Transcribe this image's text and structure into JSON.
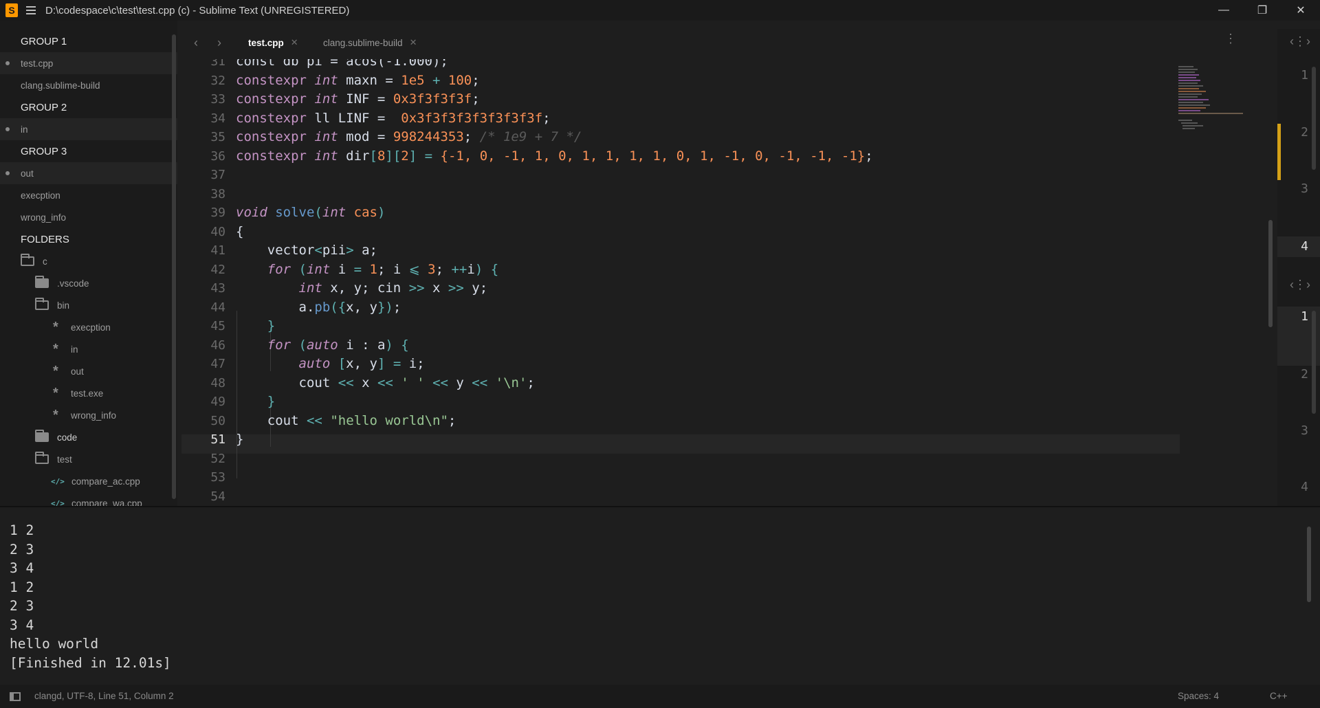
{
  "window": {
    "title": "D:\\codespace\\c\\test\\test.cpp (c) - Sublime Text (UNREGISTERED)",
    "minimize": "—",
    "restore": "❐",
    "close": "✕"
  },
  "sidebar": {
    "group1": "GROUP 1",
    "group1_files": [
      "test.cpp",
      "clang.sublime-build"
    ],
    "group2": "GROUP 2",
    "group2_files": [
      "in"
    ],
    "group3": "GROUP 3",
    "group3_files": [
      "out",
      "execption",
      "wrong_info"
    ],
    "folders_label": "FOLDERS",
    "tree": {
      "root": "c",
      "vscode": ".vscode",
      "bin": "bin",
      "bin_files": [
        "execption",
        "in",
        "out",
        "test.exe",
        "wrong_info"
      ],
      "code": "code",
      "test": "test",
      "test_files": [
        "compare_ac.cpp",
        "compare_wa.cpp"
      ]
    }
  },
  "tabs": [
    {
      "label": "test.cpp",
      "active": true
    },
    {
      "label": "clang.sublime-build",
      "active": false
    }
  ],
  "editor": {
    "first_line_fragment": "const db pi = acos(-1.000);",
    "line_numbers": [
      "31",
      "32",
      "33",
      "34",
      "35",
      "36",
      "37",
      "38",
      "39",
      "40",
      "41",
      "42",
      "43",
      "44",
      "45",
      "46",
      "47",
      "48",
      "49",
      "50",
      "51",
      "52",
      "53",
      "54"
    ],
    "current_line": "51",
    "tokens": {
      "constexpr": "constexpr",
      "int": "int",
      "ll": "ll",
      "maxn": " maxn = ",
      "maxn_v1": "1e5",
      "plus": " + ",
      "maxn_v2": "100",
      "inf": " INF = ",
      "inf_v": "0x3f3f3f3f",
      "linf": " LINF =  ",
      "linf_v": "0x3f3f3f3f3f3f3f3f",
      "mod": " mod = ",
      "mod_v": "998244353",
      "mod_c": "/* 1e9 + 7 */",
      "dir": " dir",
      "dir_vals": "{-1, 0, -1, 1, 0, 1, 1, 1, 1, 0, 1, -1, 0, -1, -1, -1}",
      "void": "void",
      "solve": "solve",
      "cas": "cas",
      "vector": "vector",
      "pii": "pii",
      "for": "for",
      "auto": "auto",
      "cin": "cin",
      "cout": "cout",
      "pb": "pb",
      "nl": "'\\n'",
      "sp": "' '",
      "hello": "\"hello world\\n\""
    }
  },
  "right_pane": {
    "top_numbers": [
      "1",
      "2",
      "3",
      "4"
    ],
    "bottom_numbers": [
      "1",
      "2",
      "3",
      "4"
    ]
  },
  "output": {
    "lines": [
      "1 2",
      "2 3",
      "3 4",
      "1 2",
      "2 3",
      "3 4",
      "hello world",
      "[Finished in 12.01s]"
    ]
  },
  "status": {
    "left": "clangd, UTF-8, Line 51, Column 2",
    "spaces": "Spaces: 4",
    "syntax": "C++"
  }
}
